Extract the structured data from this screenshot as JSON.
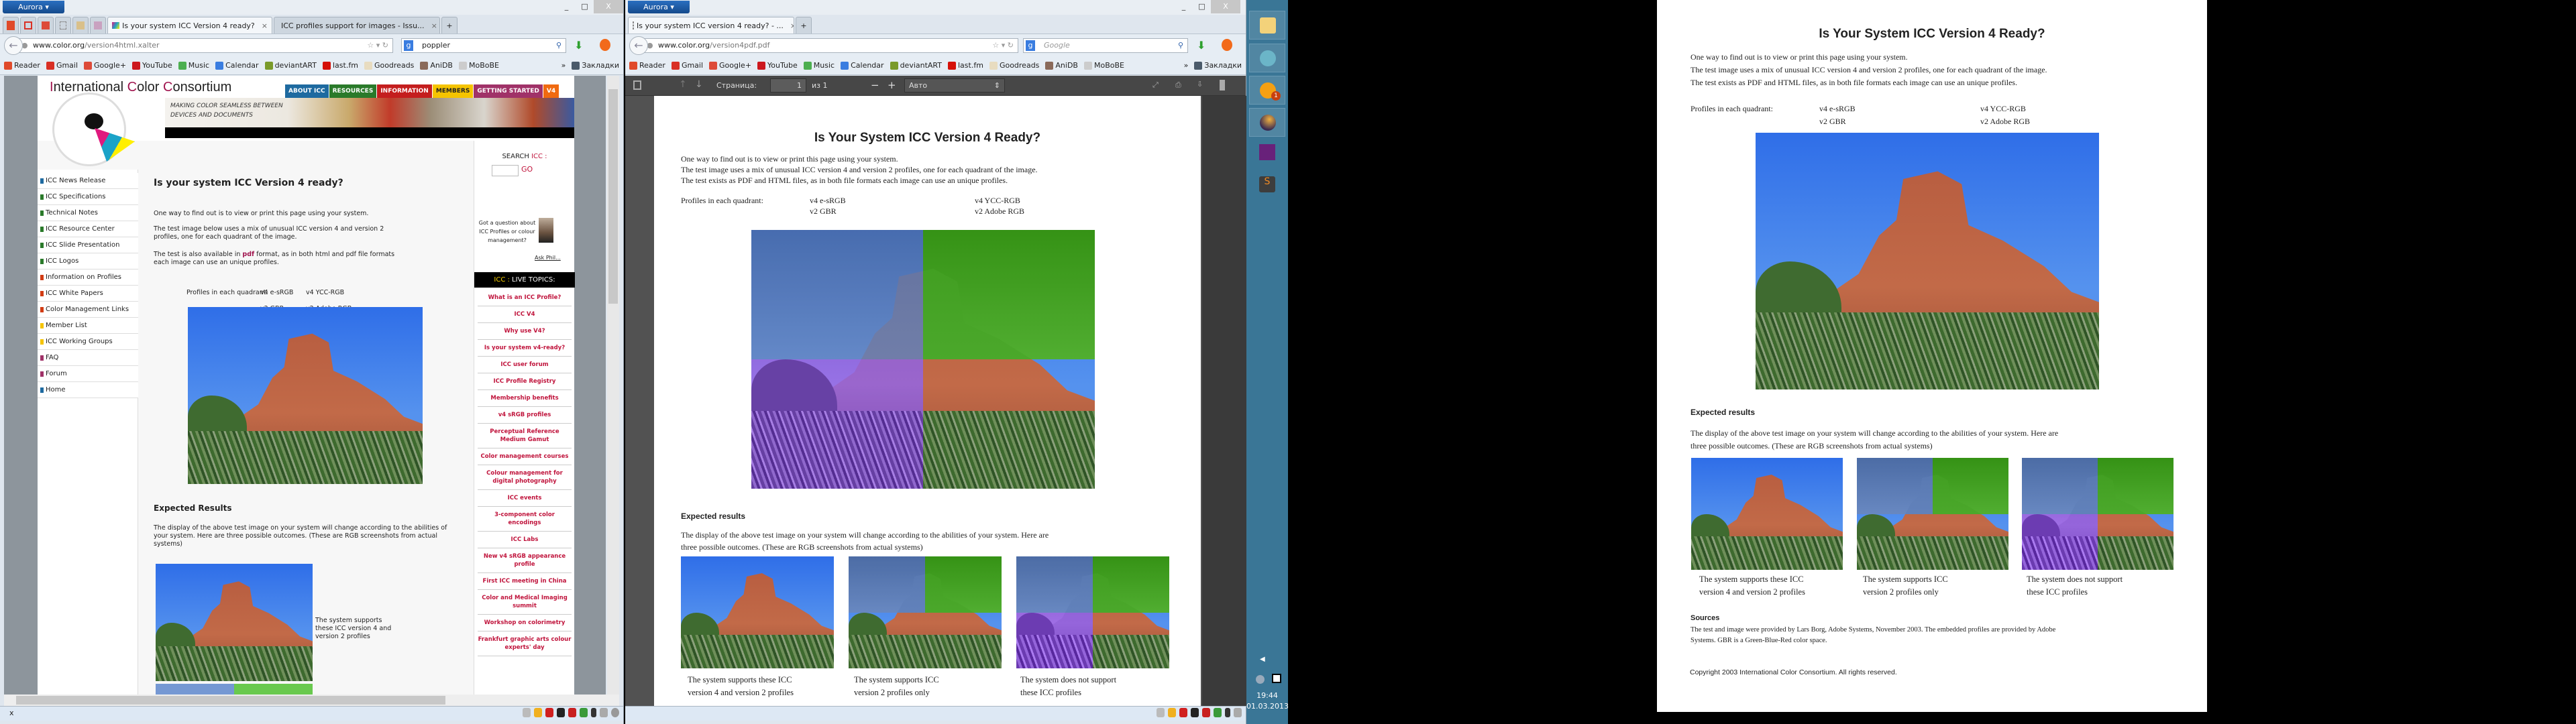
{
  "browser_left": {
    "app_button": "Aurora",
    "window_controls": {
      "minimize": "_",
      "maximize": "□",
      "close": "X"
    },
    "tabs": [
      {
        "label": "Is your system ICC Version 4 ready?",
        "active": true
      },
      {
        "label": "ICC profiles support for images - Issu...",
        "active": false
      }
    ],
    "new_tab": "+",
    "url": {
      "domain": "www.color.org",
      "path": "/version4html.xalter"
    },
    "search_value": "poppler",
    "status_close": "x"
  },
  "browser_right": {
    "app_button": "Aurora",
    "window_controls": {
      "minimize": "_",
      "maximize": "□",
      "close": "X"
    },
    "tabs": [
      {
        "label": "Is your system ICC version 4 ready? - ...",
        "active": true
      }
    ],
    "new_tab": "+",
    "url": {
      "domain": "www.color.org",
      "path": "/version4pdf.pdf"
    },
    "search_placeholder": "Google",
    "pdf_toolbar": {
      "page_label": "Страница:",
      "page_value": "1",
      "page_of": "из 1",
      "zoom_minus": "−",
      "zoom_plus": "+",
      "zoom_value": "Авто"
    }
  },
  "bookmarks": [
    {
      "label": "Reader",
      "color": "#e04a2a"
    },
    {
      "label": "Gmail",
      "color": "#d93025"
    },
    {
      "label": "Google+",
      "color": "#dd4b39"
    },
    {
      "label": "YouTube",
      "color": "#cc181e"
    },
    {
      "label": "Music",
      "color": "#4caf50"
    },
    {
      "label": "Calendar",
      "color": "#3a7de0"
    },
    {
      "label": "deviantART",
      "color": "#7a9a2a"
    },
    {
      "label": "last.fm",
      "color": "#d51007"
    },
    {
      "label": "Goodreads",
      "color": "#e8dcc0"
    },
    {
      "label": "AniDB",
      "color": "#8a6a5a"
    },
    {
      "label": "MoBoBE",
      "color": "#cccccc"
    }
  ],
  "bookmarks_overflow": "»",
  "bookmarks_folder": "Закладки",
  "icc_site": {
    "org_name": {
      "p1": "I",
      "p2": "nternational ",
      "p3": "C",
      "p4": "olor ",
      "p5": "C",
      "p6": "onsortium"
    },
    "tagline_1": "MAKING COLOR SEAMLESS BETWEEN",
    "tagline_2": "DEVICES AND DOCUMENTS",
    "top_nav": [
      {
        "label": "ABOUT ICC",
        "color": "#1e6aa0"
      },
      {
        "label": "RESOURCES",
        "color": "#2a7a2a"
      },
      {
        "label": "INFORMATION",
        "color": "#c41e1e"
      },
      {
        "label": "MEMBERS",
        "color": "#f5c400"
      },
      {
        "label": "GETTING STARTED",
        "color": "#a03268"
      },
      {
        "label": "V4",
        "color": "#f06a10"
      }
    ],
    "left_nav": [
      {
        "label": "ICC News Release",
        "color": "#1e6aa0"
      },
      {
        "label": "ICC Specifications",
        "color": "#2a7a2a"
      },
      {
        "label": "Technical Notes",
        "color": "#2a7a2a"
      },
      {
        "label": "ICC Resource Center",
        "color": "#2a7a2a"
      },
      {
        "label": "ICC Slide Presentation",
        "color": "#2a7a2a"
      },
      {
        "label": "ICC Logos",
        "color": "#2a7a2a"
      },
      {
        "label": "Information on Profiles",
        "color": "#d23c14"
      },
      {
        "label": "ICC White Papers",
        "color": "#d23c14"
      },
      {
        "label": "Color Management Links",
        "color": "#d23c14"
      },
      {
        "label": "Member List",
        "color": "#f5c400"
      },
      {
        "label": "ICC Working Groups",
        "color": "#f5c400"
      },
      {
        "label": "FAQ",
        "color": "#a03268"
      },
      {
        "label": "Forum",
        "color": "#a03268"
      },
      {
        "label": "Home",
        "color": "#1e6aa0"
      }
    ],
    "title": "Is your system ICC Version 4 ready?",
    "intro": "One way to find out is to view or print this page using your system.",
    "para2": "The test image below uses a mix of unusual ICC version 4 and version 2 profiles, one for each quadrant of the image.",
    "para3_a": "The test is also available in ",
    "para3_link": "pdf",
    "para3_b": " format, as in both html and pdf file formats each image can use an unique profiles.",
    "profiles_label": "Profiles in each quadrant:",
    "profiles": [
      "v4 e-sRGB",
      "v4 YCC-RGB",
      "v2 GBR",
      "v2 Adobe RGB"
    ],
    "expected_heading": "Expected Results",
    "expected_text": "The display of the above test image on your system will change according to the abilities of your system. Here are three possible outcomes. (These are RGB screenshots from actual systems)",
    "outcome_1": "The system supports these ICC version 4 and version 2 profiles",
    "search_label_a": "SEARCH ",
    "search_label_b": "ICC :",
    "search_go": "GO",
    "question": "Got a question about ICC Profiles or colour management?",
    "ask_phil": "Ask Phil...",
    "live_topics_a": "ICC : ",
    "live_topics_b": "LIVE TOPICS:",
    "topics": [
      "What is an ICC Profile?",
      "ICC V4",
      "Why use V4?",
      "Is your system v4-ready?",
      "ICC user forum",
      "ICC Profile Registry",
      "Membership benefits",
      "v4 sRGB profiles",
      "Perceptual Reference Medium Gamut",
      "Color management courses",
      "Colour management for digital photography",
      "ICC events",
      "3-component color encodings",
      "ICC Labs",
      "New v4 sRGB appearance profile",
      "First ICC meeting in China",
      "Color and Medical Imaging summit",
      "Workshop on colorimetry",
      "Frankfurt graphic arts colour experts' day"
    ]
  },
  "pdf_document": {
    "title": "Is Your System ICC Version 4 Ready?",
    "line1": "One way to find out is to view or print this page using your system.",
    "line2": "The test image uses a mix of unusual ICC version 4 and version 2 profiles, one for each quadrant of the image.",
    "line3": "The test exists as PDF and HTML files, as in both file formats each image can use an unique profiles.",
    "profiles_label": "Profiles in each quadrant:",
    "profiles": [
      "v4 e-sRGB",
      "v4 YCC-RGB",
      "v2 GBR",
      "v2 Adobe RGB"
    ],
    "expected_heading": "Expected results",
    "expected_text_1": "The display of the above test image on your system will change according to the abilities of your system. Here are",
    "expected_text_2": "three possible outcomes. (These are RGB screenshots from actual systems)",
    "captions": [
      [
        "The system supports these ICC",
        "version 4 and version 2 profiles"
      ],
      [
        "The system supports ICC",
        "version 2 profiles only"
      ],
      [
        "The system does not support",
        "these ICC profiles"
      ]
    ],
    "sources_heading": "Sources",
    "sources_1": "The test and image were provided by Lars Borg, Adobe Systems, November 2003. The embedded profiles are provided by Adobe",
    "sources_2": "Systems.  GBR is a Green-Blue-Red color space.",
    "copyright": "Copyright 2003 International Color Consortium. All rights reserved."
  },
  "taskbar": {
    "apps": [
      "folder-icon",
      "network-icon",
      "tumblr-notify-icon",
      "firefox-aurora-icon",
      "visual-studio-icon",
      "sublime-text-icon"
    ],
    "notification_badge": "1",
    "time": "19:44",
    "date": "01.03.2013"
  }
}
